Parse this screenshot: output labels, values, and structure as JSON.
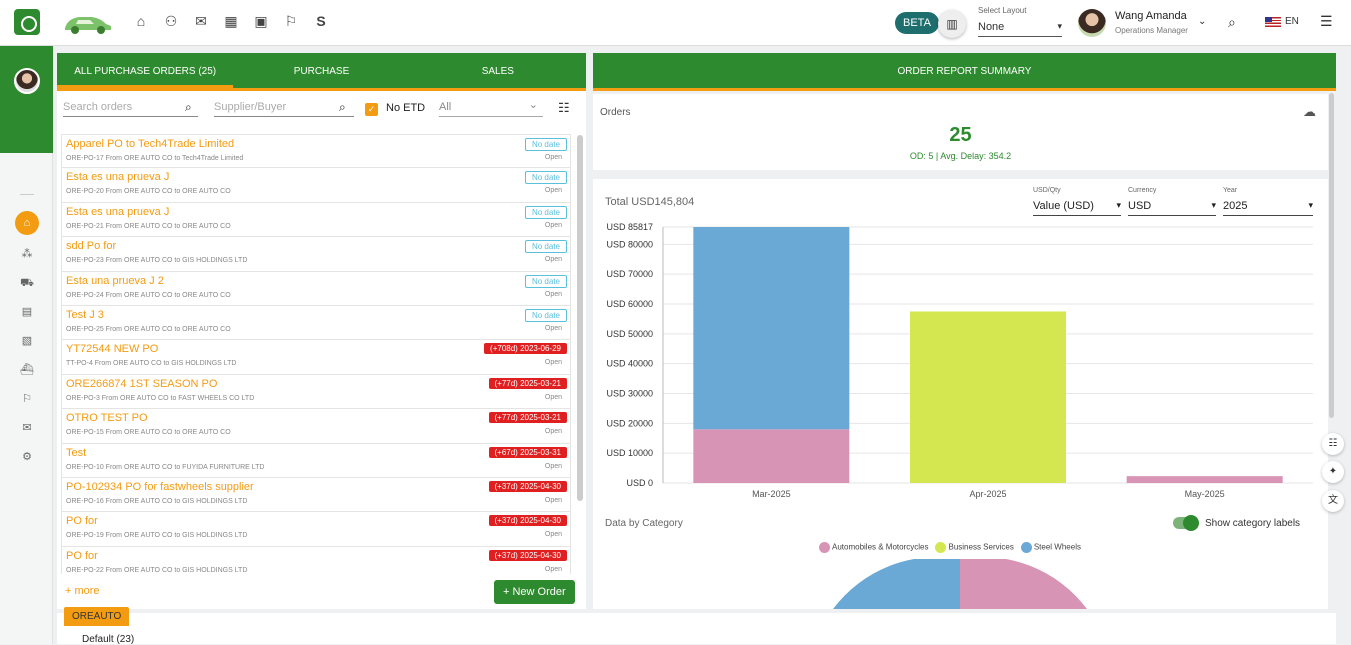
{
  "topbar": {
    "beta": "BETA",
    "select_layout_label": "Select Layout",
    "select_layout_value": "None",
    "user_name": "Wang Amanda",
    "user_role": "Operations Manager",
    "lang": "EN",
    "nav_icons": [
      "home-icon",
      "users-icon",
      "mail-icon",
      "building-icon",
      "contact-icon",
      "flag-icon"
    ],
    "nav_letter": "S"
  },
  "sidebar": {
    "icons": [
      "home-icon",
      "network-icon",
      "cart-icon",
      "document-icon",
      "clipboard-icon",
      "ship-icon",
      "flag-icon",
      "mail-icon",
      "settings-icon"
    ]
  },
  "left_panel": {
    "tabs": [
      {
        "label": "ALL PURCHASE ORDERS (25)",
        "active": true
      },
      {
        "label": "PURCHASE",
        "active": false
      },
      {
        "label": "SALES",
        "active": false
      }
    ],
    "search_placeholder": "Search orders",
    "supplier_placeholder": "Supplier/Buyer",
    "no_etd_label": "No ETD",
    "filter_value": "All",
    "orders": [
      {
        "title": "Apparel PO to Tech4Trade Limited",
        "sub": "ORE-PO-17 From ORE AUTO CO to Tech4Trade Limited",
        "badge": "No date",
        "late": false,
        "status": "Open"
      },
      {
        "title": "Esta es una prueva J",
        "sub": "ORE-PO-20 From ORE AUTO CO to ORE AUTO CO",
        "badge": "No date",
        "late": false,
        "status": "Open"
      },
      {
        "title": "Esta es una prueva J",
        "sub": "ORE-PO-21 From ORE AUTO CO to ORE AUTO CO",
        "badge": "No date",
        "late": false,
        "status": "Open"
      },
      {
        "title": "sdd Po for",
        "sub": "ORE-PO-23 From ORE AUTO CO to GIS HOLDINGS LTD",
        "badge": "No date",
        "late": false,
        "status": "Open"
      },
      {
        "title": "Esta una prueva J 2",
        "sub": "ORE-PO-24 From ORE AUTO CO to ORE AUTO CO",
        "badge": "No date",
        "late": false,
        "status": "Open"
      },
      {
        "title": "Test J 3",
        "sub": "ORE-PO-25 From ORE AUTO CO to ORE AUTO CO",
        "badge": "No date",
        "late": false,
        "status": "Open"
      },
      {
        "title": "YT72544 NEW PO",
        "sub": "TT-PO-4 From ORE AUTO CO to GIS HOLDINGS LTD",
        "badge": "(+708d) 2023-06-29",
        "late": true,
        "status": "Open"
      },
      {
        "title": "ORE266874 1ST SEASON PO",
        "sub": "ORE-PO-3 From ORE AUTO CO to FAST WHEELS CO LTD",
        "badge": "(+77d) 2025-03-21",
        "late": true,
        "status": "Open"
      },
      {
        "title": "OTRO TEST PO",
        "sub": "ORE-PO-15 From ORE AUTO CO to ORE AUTO CO",
        "badge": "(+77d) 2025-03-21",
        "late": true,
        "status": "Open"
      },
      {
        "title": "Test",
        "sub": "ORE-PO-10 From ORE AUTO CO to FUYIDA FURNITURE LTD",
        "badge": "(+67d) 2025-03-31",
        "late": true,
        "status": "Open"
      },
      {
        "title": "PO-102934 PO for fastwheels supplier",
        "sub": "ORE-PO-16 From ORE AUTO CO to GIS HOLDINGS LTD",
        "badge": "(+37d) 2025-04-30",
        "late": true,
        "status": "Open"
      },
      {
        "title": "PO for",
        "sub": "ORE-PO-19 From ORE AUTO CO to GIS HOLDINGS LTD",
        "badge": "(+37d) 2025-04-30",
        "late": true,
        "status": "Open"
      },
      {
        "title": "PO for",
        "sub": "ORE-PO-22 From ORE AUTO CO to GIS HOLDINGS LTD",
        "badge": "(+37d) 2025-04-30",
        "late": true,
        "status": "Open"
      }
    ],
    "more": "+ more",
    "new_order": "+ New Order"
  },
  "right_panel": {
    "header": "ORDER REPORT SUMMARY",
    "orders_label": "Orders",
    "orders_count": "25",
    "orders_sub": "OD: 5 | Avg. Delay: 354.2",
    "total": "Total USD145,804",
    "dropdowns": [
      {
        "label": "USD/Qty",
        "value": "Value (USD)"
      },
      {
        "label": "Currency",
        "value": "USD"
      },
      {
        "label": "Year",
        "value": "2025"
      }
    ],
    "category_label": "Data by Category",
    "toggle_label": "Show category labels"
  },
  "chart_data": {
    "type": "bar",
    "stacked": true,
    "categories": [
      "Mar-2025",
      "Apr-2025",
      "May-2025"
    ],
    "series": [
      {
        "name": "Automobiles & Motorcycles",
        "color": "#d894b4",
        "values": [
          18000,
          0,
          2300
        ]
      },
      {
        "name": "Business Services",
        "color": "#d4e650",
        "values": [
          0,
          57500,
          0
        ]
      },
      {
        "name": "Steel Wheels",
        "color": "#6aa8d6",
        "values": [
          67817,
          0,
          0
        ]
      }
    ],
    "y_ticks": [
      "USD 0",
      "USD 10000",
      "USD 20000",
      "USD 30000",
      "USD 40000",
      "USD 50000",
      "USD 60000",
      "USD 70000",
      "USD 80000",
      "USD 85817"
    ],
    "y_tick_values": [
      0,
      10000,
      20000,
      30000,
      40000,
      50000,
      60000,
      70000,
      80000,
      85817
    ],
    "ylim": [
      0,
      85817
    ],
    "grid": true
  },
  "pie_data": {
    "type": "pie",
    "legend": [
      "Automobiles & Motorcycles",
      "Business Services",
      "Steel Wheels"
    ],
    "colors": [
      "#d894b4",
      "#d4e650",
      "#6aa8d6"
    ]
  },
  "footer": {
    "tag": "OREAUTO",
    "default_label": "Default (23)"
  }
}
